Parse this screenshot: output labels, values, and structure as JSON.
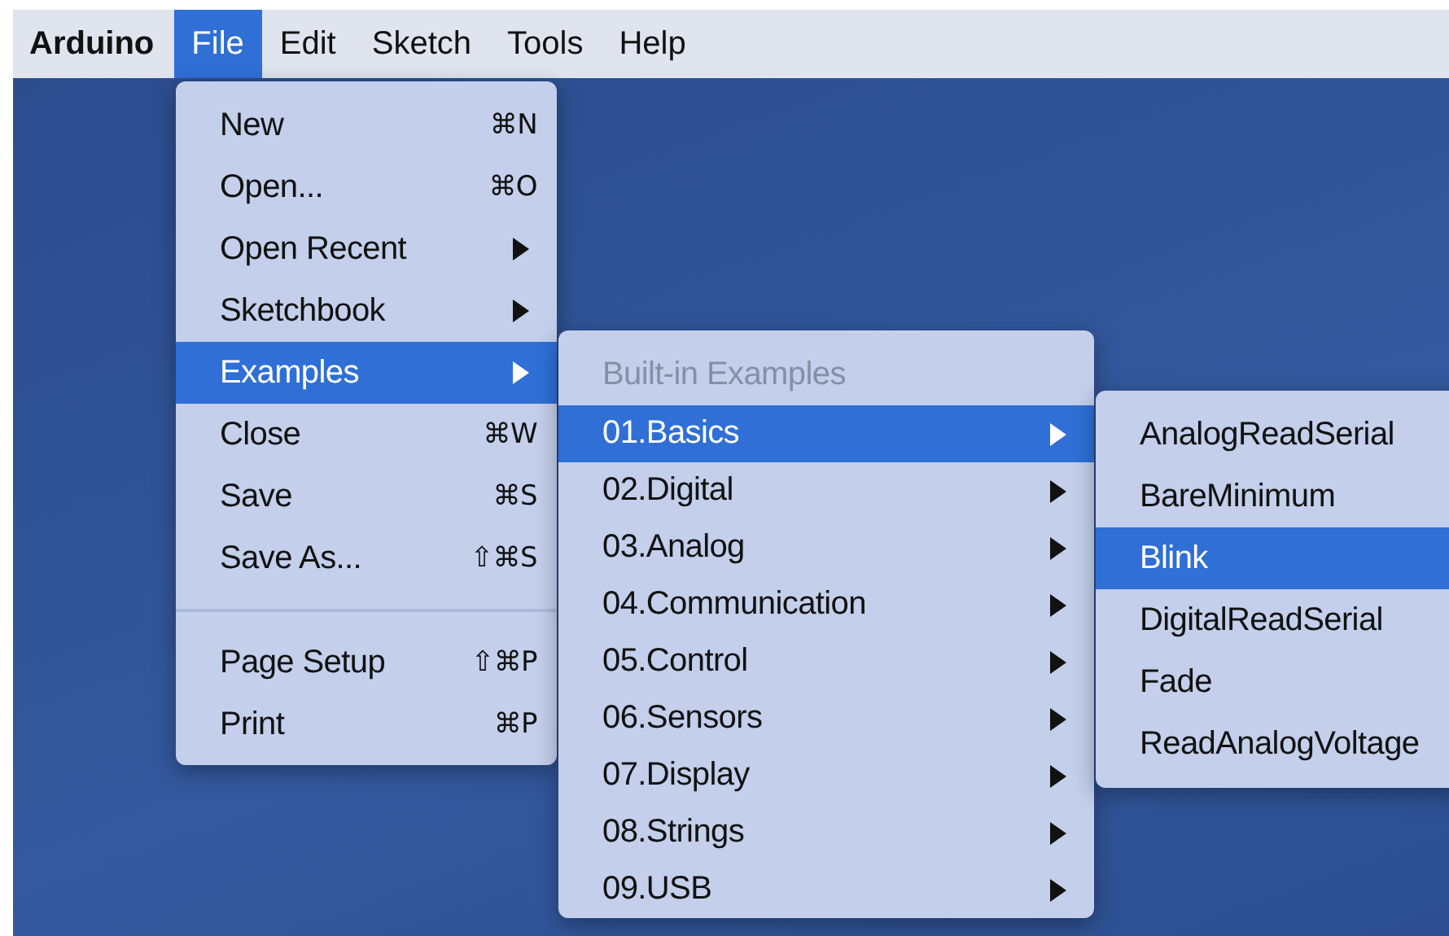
{
  "menu_bar": {
    "app_name": "Arduino",
    "items": [
      {
        "label": "File",
        "selected": true
      },
      {
        "label": "Edit",
        "selected": false
      },
      {
        "label": "Sketch",
        "selected": false
      },
      {
        "label": "Tools",
        "selected": false
      },
      {
        "label": "Help",
        "selected": false
      }
    ]
  },
  "file_menu": {
    "items": [
      {
        "kind": "item",
        "label": "New",
        "shortcut": "⌘N",
        "selected": false
      },
      {
        "kind": "item",
        "label": "Open...",
        "shortcut": "⌘O",
        "selected": false
      },
      {
        "kind": "submenu",
        "label": "Open Recent",
        "selected": false
      },
      {
        "kind": "submenu",
        "label": "Sketchbook",
        "selected": false
      },
      {
        "kind": "submenu",
        "label": "Examples",
        "selected": true
      },
      {
        "kind": "item",
        "label": "Close",
        "shortcut": "⌘W",
        "selected": false
      },
      {
        "kind": "item",
        "label": "Save",
        "shortcut": "⌘S",
        "selected": false
      },
      {
        "kind": "item",
        "label": "Save As...",
        "shortcut": "⇧⌘S",
        "selected": false
      },
      {
        "kind": "separator"
      },
      {
        "kind": "item",
        "label": "Page Setup",
        "shortcut": "⇧⌘P",
        "selected": false
      },
      {
        "kind": "item",
        "label": "Print",
        "shortcut": "⌘P",
        "selected": false
      }
    ]
  },
  "examples_menu": {
    "header": "Built-in Examples",
    "items": [
      {
        "label": "01.Basics",
        "selected": true
      },
      {
        "label": "02.Digital",
        "selected": false
      },
      {
        "label": "03.Analog",
        "selected": false
      },
      {
        "label": "04.Communication",
        "selected": false
      },
      {
        "label": "05.Control",
        "selected": false
      },
      {
        "label": "06.Sensors",
        "selected": false
      },
      {
        "label": "07.Display",
        "selected": false
      },
      {
        "label": "08.Strings",
        "selected": false
      },
      {
        "label": "09.USB",
        "selected": false
      }
    ]
  },
  "basics_menu": {
    "items": [
      {
        "label": "AnalogReadSerial",
        "selected": false
      },
      {
        "label": "BareMinimum",
        "selected": false
      },
      {
        "label": "Blink",
        "selected": true
      },
      {
        "label": "DigitalReadSerial",
        "selected": false
      },
      {
        "label": "Fade",
        "selected": false
      },
      {
        "label": "ReadAnalogVoltage",
        "selected": false
      }
    ]
  }
}
